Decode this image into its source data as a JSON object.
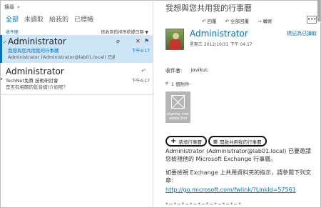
{
  "search": {
    "label": "搜尋"
  },
  "filters": [
    "全部",
    "未讀取",
    "給我的",
    "已標幟"
  ],
  "sortbar": {
    "folder": "收件匣",
    "sort": "依收到的排序依據日期 ▼"
  },
  "messages": [
    {
      "sender": "Administrator",
      "subject": "我想與您共用我的行事曆",
      "preview": "Administrator (Administrator@lab01.local) 已經",
      "time": "下午4:17"
    },
    {
      "sender": "Administrator",
      "subject": "TechNet免費 技術研討會",
      "preview": "是否有相關的影音檔(介紹呢？",
      "time": "下午4:17"
    }
  ],
  "reading": {
    "title": "我想與您共用我的行事曆",
    "actions": [
      "回覆",
      "全部回覆",
      "轉寄"
    ],
    "more": "•••",
    "sender": "Administrator",
    "date": "星期三 2012/10/31 下午 04:17",
    "mark_unread": "標記為已讀取",
    "to_label": "收件者:",
    "to_value": "jovikui;",
    "att_count": "1 個附件",
    "att_name": "sharing_met adata.xml",
    "buttons": [
      "新增行事曆",
      "開啟共用我的行事曆"
    ],
    "para1": "Administrator (Administrator@lab01.local) 已要邀請您檢視他的 Microsoft Exchange 行事曆。",
    "para2": "如要檢視 Exchange 上共用資料夾的指示，請參閱下列文章:",
    "link": "http://go.microsoft.com/fwlink/?LinkId=57561",
    "dots": "*~*~*~*~*~*~*~*~*~*"
  }
}
